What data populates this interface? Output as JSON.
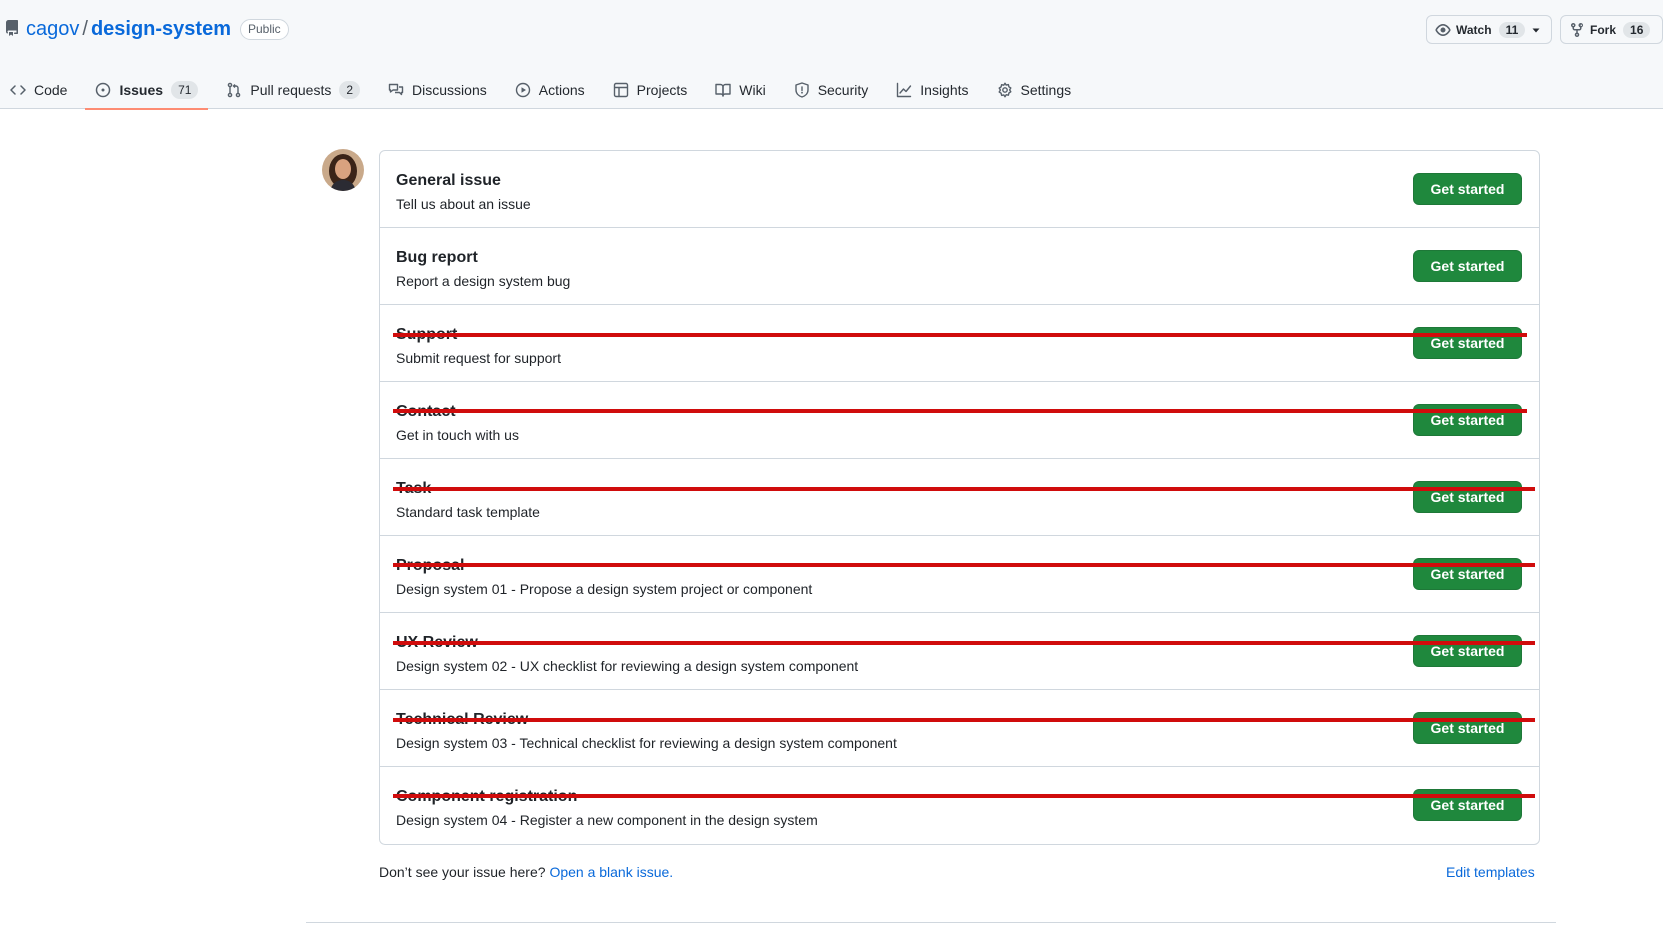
{
  "repo": {
    "owner": "cagov",
    "separator": "/",
    "name": "design-system",
    "visibility": "Public"
  },
  "header_actions": {
    "watch_label": "Watch",
    "watch_count": "11",
    "fork_label": "Fork",
    "fork_count": "16"
  },
  "tabs": [
    {
      "label": "Code",
      "icon": "code-icon",
      "count": null,
      "selected": false
    },
    {
      "label": "Issues",
      "icon": "issue-opened-icon",
      "count": "71",
      "selected": true
    },
    {
      "label": "Pull requests",
      "icon": "git-pull-request-icon",
      "count": "2",
      "selected": false
    },
    {
      "label": "Discussions",
      "icon": "comment-discussion-icon",
      "count": null,
      "selected": false
    },
    {
      "label": "Actions",
      "icon": "play-icon",
      "count": null,
      "selected": false
    },
    {
      "label": "Projects",
      "icon": "table-icon",
      "count": null,
      "selected": false
    },
    {
      "label": "Wiki",
      "icon": "book-icon",
      "count": null,
      "selected": false
    },
    {
      "label": "Security",
      "icon": "shield-icon",
      "count": null,
      "selected": false
    },
    {
      "label": "Insights",
      "icon": "graph-icon",
      "count": null,
      "selected": false
    },
    {
      "label": "Settings",
      "icon": "gear-icon",
      "count": null,
      "selected": false
    }
  ],
  "templates": [
    {
      "name": "General issue",
      "description": "Tell us about an issue",
      "button": "Get started",
      "struck": false
    },
    {
      "name": "Bug report",
      "description": "Report a design system bug",
      "button": "Get started",
      "struck": false
    },
    {
      "name": "Support",
      "description": "Submit request for support",
      "button": "Get started",
      "struck": true
    },
    {
      "name": "Contact",
      "description": "Get in touch with us",
      "button": "Get started",
      "struck": true
    },
    {
      "name": "Task",
      "description": "Standard task template",
      "button": "Get started",
      "struck": true
    },
    {
      "name": "Proposal",
      "description": "Design system 01 - Propose a design system project or component",
      "button": "Get started",
      "struck": true
    },
    {
      "name": "UX Review",
      "description": "Design system 02 - UX checklist for reviewing a design system component",
      "button": "Get started",
      "struck": true
    },
    {
      "name": "Technical Review",
      "description": "Design system 03 - Technical checklist for reviewing a design system component",
      "button": "Get started",
      "struck": true
    },
    {
      "name": "Component registration",
      "description": "Design system 04 - Register a new component in the design system",
      "button": "Get started",
      "struck": true
    }
  ],
  "footer": {
    "prompt": "Don’t see your issue here?",
    "blank_issue_link": "Open a blank issue.",
    "edit_templates": "Edit templates"
  },
  "colors": {
    "accent_link": "#0969da",
    "primary_button": "#1f883d",
    "selected_tab_underline": "#fd8c73",
    "strike_annotation": "#d00c0c"
  }
}
